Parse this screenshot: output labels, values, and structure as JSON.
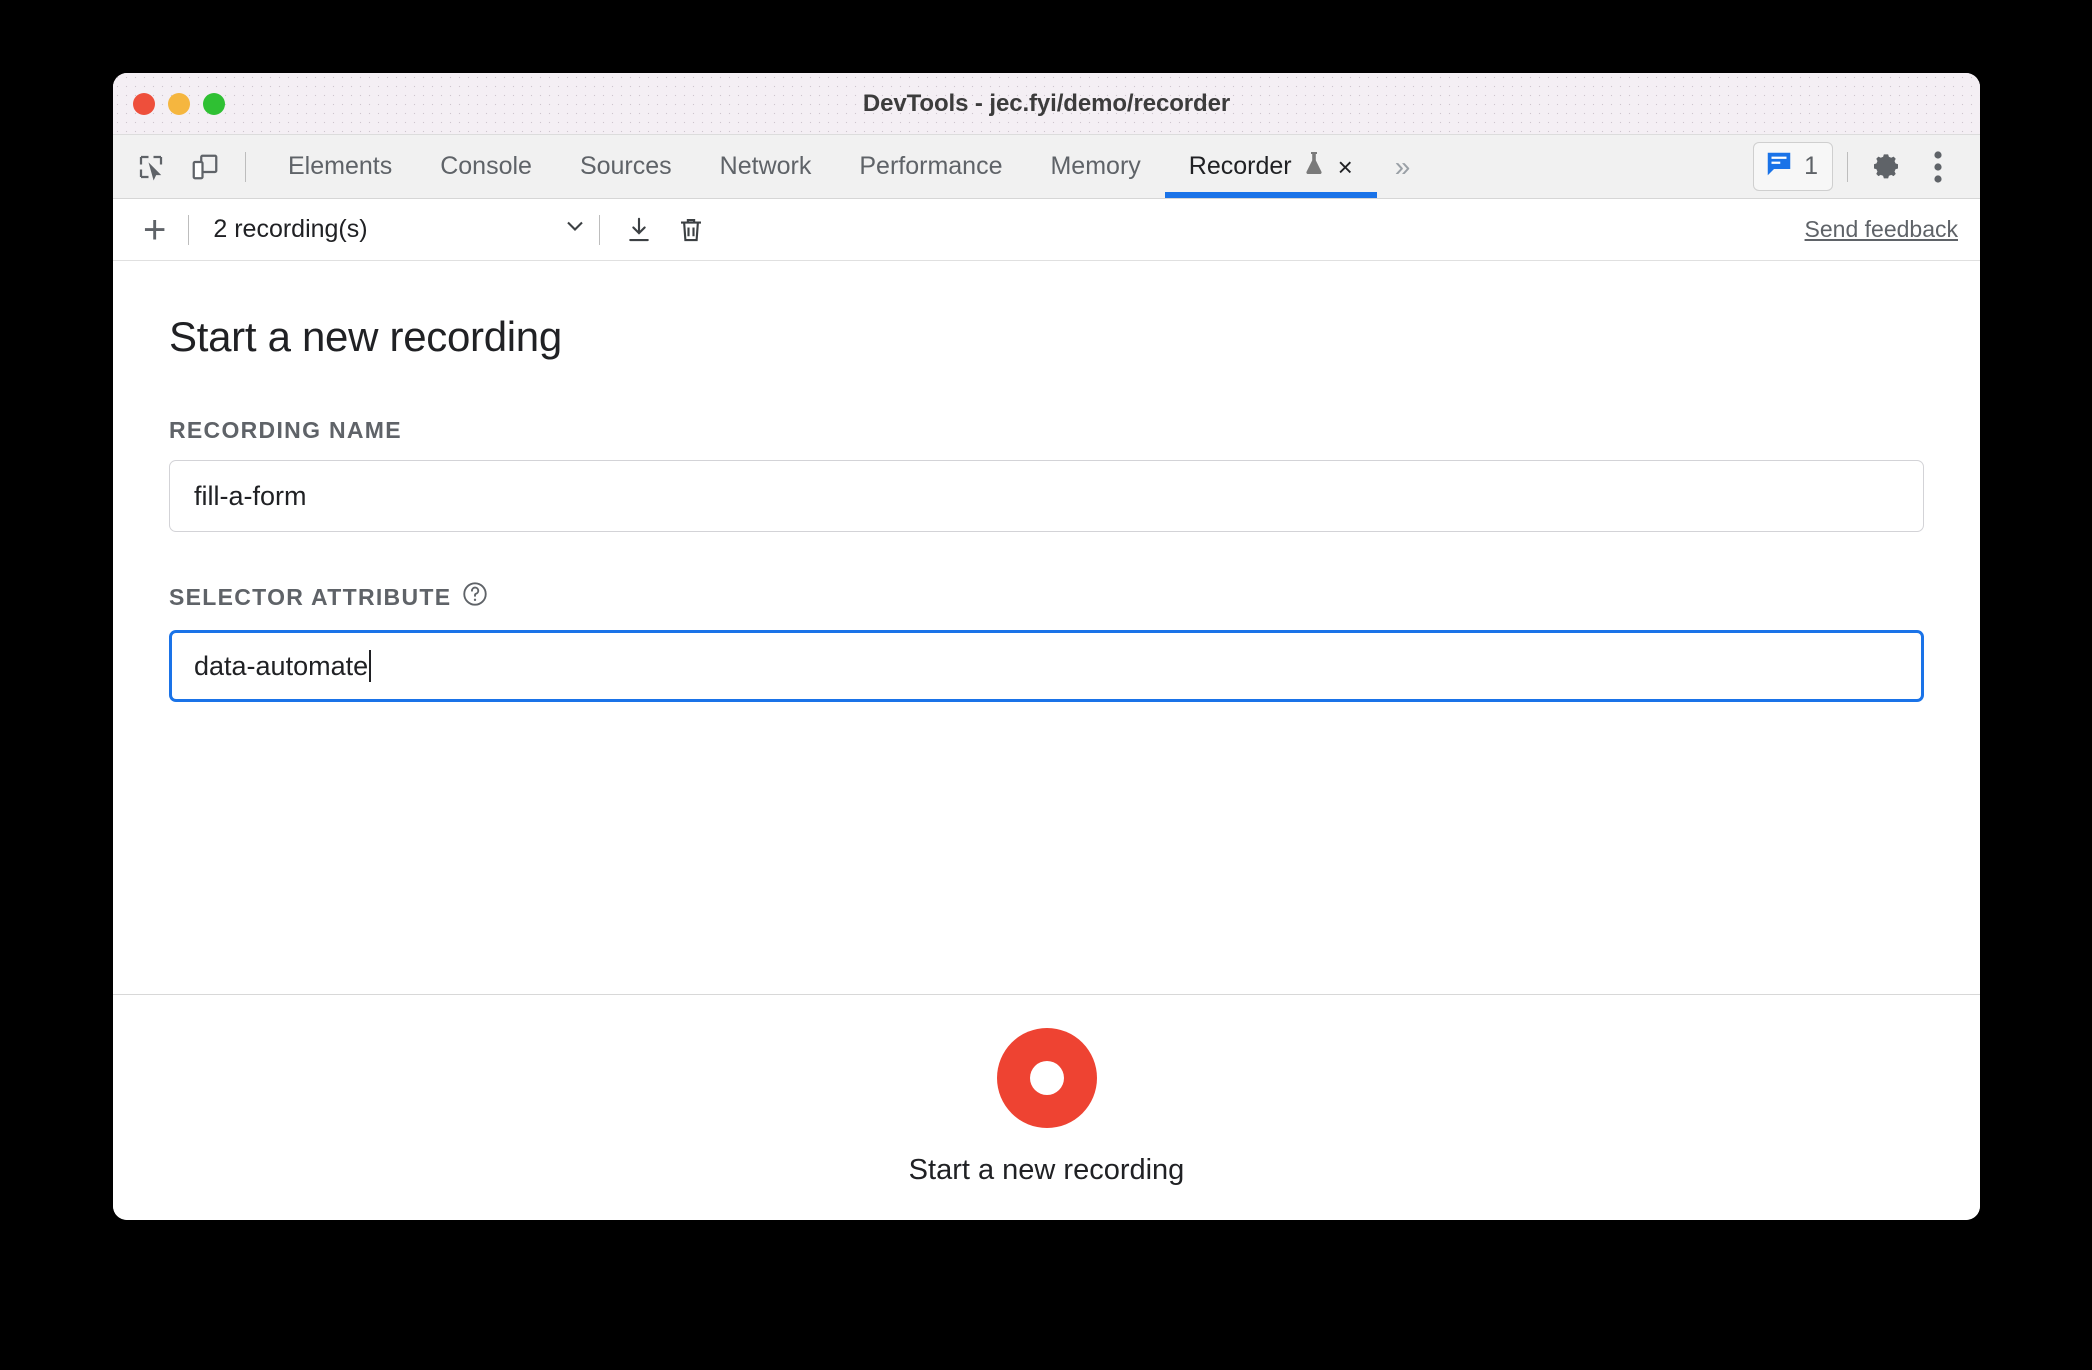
{
  "window": {
    "title": "DevTools - jec.fyi/demo/recorder",
    "traffic_lights": [
      "close",
      "minimize",
      "zoom"
    ]
  },
  "tabbar": {
    "left_icons": [
      {
        "name": "inspect-element-icon",
        "label": "Inspect element"
      },
      {
        "name": "device-toolbar-icon",
        "label": "Toggle device toolbar"
      }
    ],
    "tabs": [
      {
        "label": "Elements",
        "active": false
      },
      {
        "label": "Console",
        "active": false
      },
      {
        "label": "Sources",
        "active": false
      },
      {
        "label": "Network",
        "active": false
      },
      {
        "label": "Performance",
        "active": false
      },
      {
        "label": "Memory",
        "active": false
      },
      {
        "label": "Recorder",
        "active": true,
        "experiment": true,
        "closable": true
      }
    ],
    "more_tabs_glyph": "»",
    "close_glyph": "×",
    "message_count": "1",
    "right_icons": [
      {
        "name": "messages-icon"
      },
      {
        "name": "gear-icon"
      },
      {
        "name": "more-options-icon"
      }
    ],
    "active_tab_accent": "#1a73e8"
  },
  "recorder_toolbar": {
    "add_label": "+",
    "recordings_selector": "2 recording(s)",
    "download_label": "Export recording",
    "delete_label": "Delete recording",
    "feedback_label": "Send feedback"
  },
  "main": {
    "heading": "Start a new recording",
    "recording_name": {
      "label": "RECORDING NAME",
      "value": "fill-a-form",
      "placeholder": "Recording name"
    },
    "selector_attribute": {
      "label": "SELECTOR ATTRIBUTE",
      "help_glyph": "?",
      "value": "data-automate",
      "placeholder": "Selector attribute",
      "focused": true
    }
  },
  "footer": {
    "record_button_label": "Start a new recording",
    "record_button_color": "#ee4332"
  }
}
